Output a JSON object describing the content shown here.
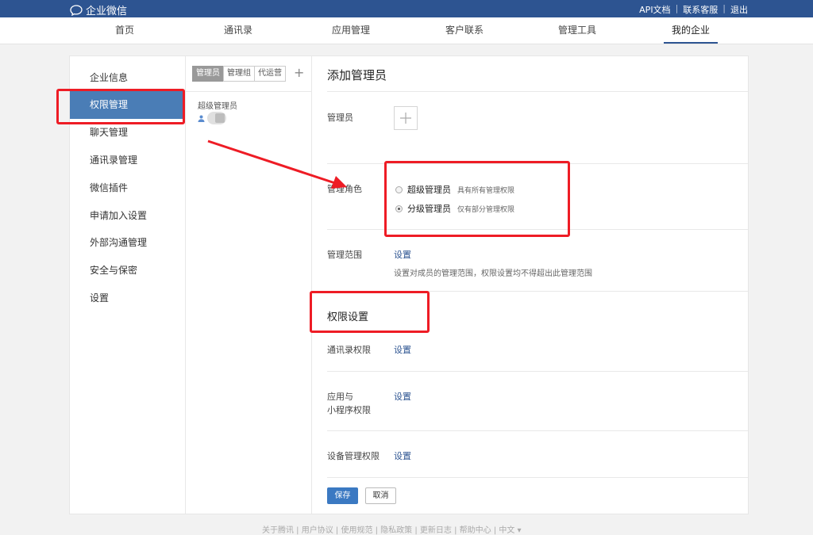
{
  "topbar": {
    "logo_text": "企业微信",
    "links": [
      "API文档",
      "联系客服",
      "退出"
    ]
  },
  "nav": {
    "items": [
      "首页",
      "通讯录",
      "应用管理",
      "客户联系",
      "管理工具",
      "我的企业"
    ],
    "active_index": 5
  },
  "sidebar": {
    "items": [
      "企业信息",
      "权限管理",
      "聊天管理",
      "通讯录管理",
      "微信插件",
      "申请加入设置",
      "外部沟通管理",
      "安全与保密",
      "设置"
    ],
    "active_index": 1
  },
  "middle": {
    "tabs": [
      "管理员",
      "管理组",
      "代运营"
    ],
    "active_tab": 0,
    "add_icon": "plus-icon",
    "group_label": "超级管理员"
  },
  "form": {
    "title": "添加管理员",
    "admin_label": "管理员",
    "role_label": "管理角色",
    "roles": [
      {
        "title": "超级管理员",
        "desc": "具有所有管理权限",
        "checked": false
      },
      {
        "title": "分级管理员",
        "desc": "仅有部分管理权限",
        "checked": true
      }
    ],
    "scope_label": "管理范围",
    "scope_link": "设置",
    "scope_desc": "设置对成员的管理范围，权限设置均不得超出此管理范围",
    "perm_title": "权限设置",
    "contacts_perm_label": "通讯录权限",
    "contacts_perm_link": "设置",
    "app_perm_label_line1": "应用与",
    "app_perm_label_line2": "小程序权限",
    "app_perm_link": "设置",
    "device_perm_label": "设备管理权限",
    "device_perm_link": "设置",
    "save_label": "保存",
    "cancel_label": "取消"
  },
  "footer": {
    "text": "关于腾讯 | 用户协议 | 使用规范 | 隐私政策 | 更新日志 | 帮助中心 | 中文 ▾"
  },
  "colors": {
    "topbar": "#2d5491",
    "active_menu": "#4a7db6",
    "link": "#2d5491",
    "annotation": "#ee1c25"
  }
}
